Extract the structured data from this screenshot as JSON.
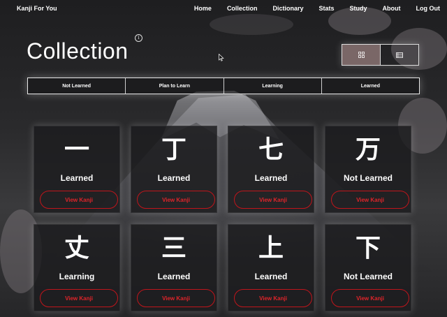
{
  "nav": {
    "brand": "Kanji For You",
    "links": [
      "Home",
      "Collection",
      "Dictionary",
      "Stats",
      "Study",
      "About",
      "Log Out"
    ]
  },
  "page": {
    "title": "Collection",
    "info_icon": "info-icon"
  },
  "view_toggle": {
    "options": [
      {
        "icon": "grid-icon",
        "active": true
      },
      {
        "icon": "list-icon",
        "active": false
      }
    ]
  },
  "filters": [
    "Not Learned",
    "Plan to Learn",
    "Learning",
    "Learned"
  ],
  "cards": [
    {
      "kanji": "一",
      "status": "Learned",
      "button": "View Kanji"
    },
    {
      "kanji": "丁",
      "status": "Learned",
      "button": "View Kanji"
    },
    {
      "kanji": "七",
      "status": "Learned",
      "button": "View Kanji"
    },
    {
      "kanji": "万",
      "status": "Not Learned",
      "button": "View Kanji"
    },
    {
      "kanji": "丈",
      "status": "Learning",
      "button": "View Kanji"
    },
    {
      "kanji": "三",
      "status": "Learned",
      "button": "View Kanji"
    },
    {
      "kanji": "上",
      "status": "Learned",
      "button": "View Kanji"
    },
    {
      "kanji": "下",
      "status": "Not Learned",
      "button": "View Kanji"
    }
  ],
  "colors": {
    "accent": "#c0151b",
    "toggle_active": "#7a6767"
  }
}
